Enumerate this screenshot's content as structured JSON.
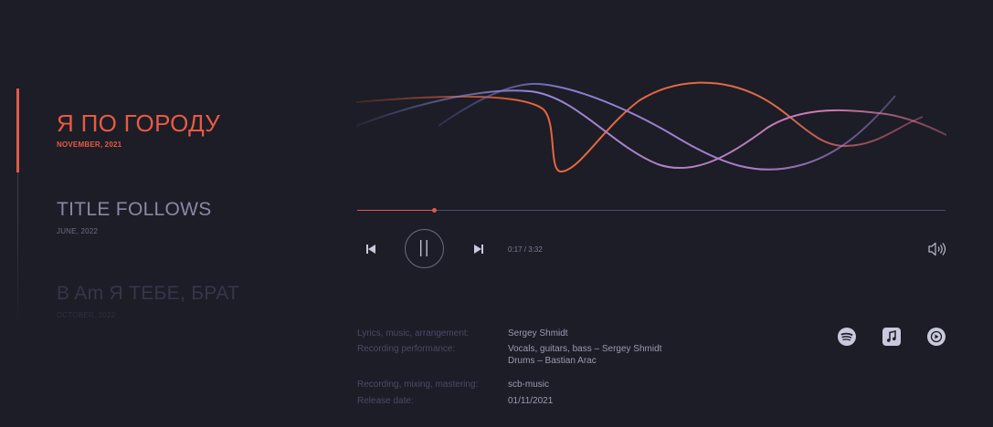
{
  "tracks": [
    {
      "title": "Я ПО ГОРОДУ",
      "date": "NOVEMBER, 2021"
    },
    {
      "title": "TITLE FOLLOWS",
      "date": "JUNE, 2022"
    },
    {
      "title": "B Am Я ТЕБЕ, БРАТ",
      "date": "OCTOBER, 2022"
    }
  ],
  "player": {
    "time": "0:17 / 3:32",
    "progress": 0.13
  },
  "credits": [
    {
      "label": "Lyrics, music, arrangement:",
      "value": [
        "Sergey Shmidt"
      ]
    },
    {
      "label": "Recording performance:",
      "value": [
        "Vocals, guitars, bass – Sergey Shmidt",
        "Drums – Bastian Arac"
      ]
    },
    {
      "label": "Recording, mixing, mastering:",
      "value": [
        "scb-music"
      ]
    },
    {
      "label": "Release date:",
      "value": [
        "01/11/2021"
      ]
    }
  ],
  "colors": {
    "accent": "#e05a48",
    "background": "#1c1d26",
    "wave_purple": "#9a86d8",
    "wave_orange": "#e8643c"
  },
  "icons": [
    "prev-track-icon",
    "pause-icon",
    "next-track-icon",
    "volume-icon",
    "spotify-icon",
    "apple-music-icon",
    "youtube-music-icon"
  ]
}
